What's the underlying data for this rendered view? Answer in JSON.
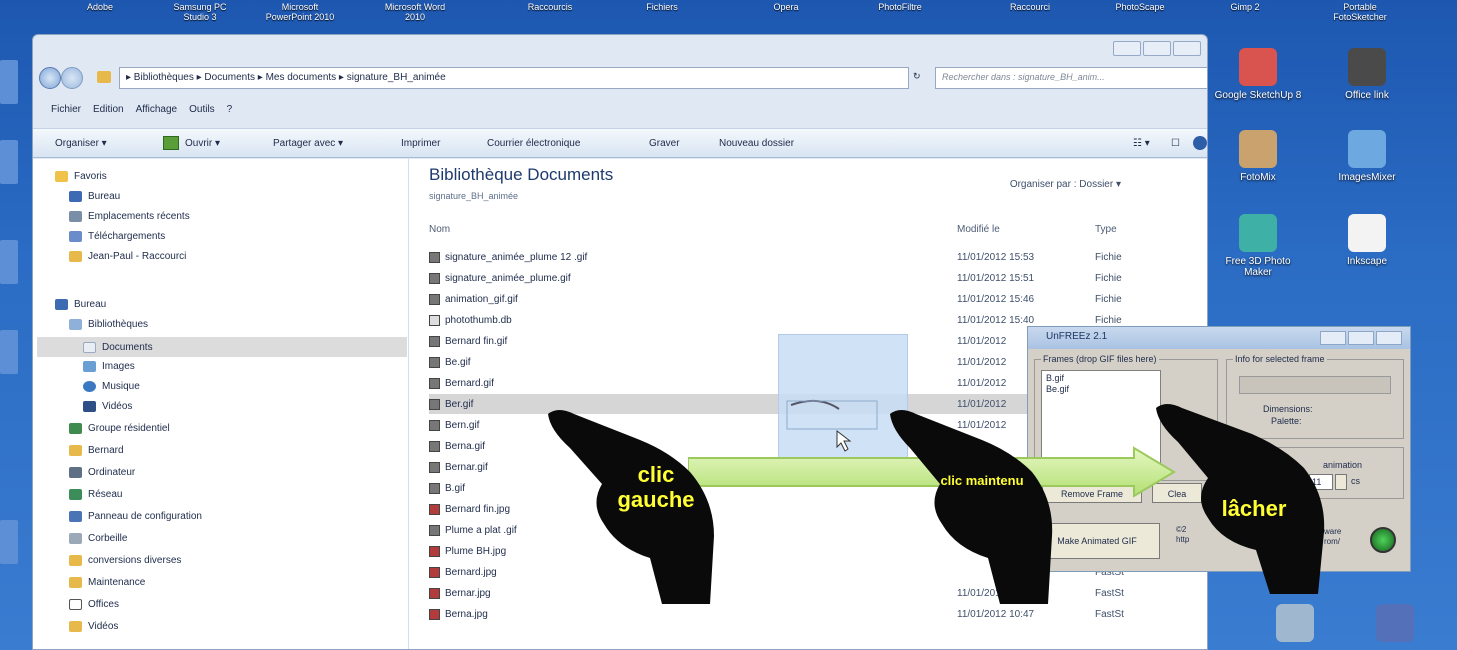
{
  "desktop": {
    "top_icons": [
      "Adobe",
      "Samsung PC Studio 3",
      "Microsoft PowerPoint 2010",
      "Microsoft Word 2010",
      "Raccourcis",
      "Fichiers",
      "Opera",
      "PhotoFiltre",
      "Raccourci",
      "PhotoScape",
      "Gimp 2",
      "Portable FotoSketcher"
    ],
    "right_icons": [
      {
        "name": "Google SketchUp 8",
        "color": "#d9534f"
      },
      {
        "name": "Office link",
        "color": "#4a4a4a"
      },
      {
        "name": "FotoMix",
        "color": "#c9a26e"
      },
      {
        "name": "ImagesMixer",
        "color": "#6ea8e0"
      },
      {
        "name": "Free 3D Photo Maker",
        "color": "#3fb0a6"
      },
      {
        "name": "Inkscape",
        "color": "#ffffff"
      }
    ]
  },
  "explorer": {
    "breadcrumb": "▸ Bibliothèques ▸ Documents ▸ Mes documents ▸ signature_BH_animée",
    "search_placeholder": "Rechercher dans : signature_BH_anim...",
    "menu": [
      "Fichier",
      "Edition",
      "Affichage",
      "Outils",
      "?"
    ],
    "toolbar": {
      "organize": "Organiser ▾",
      "open": "Ouvrir ▾",
      "share": "Partager avec ▾",
      "print": "Imprimer",
      "email": "Courrier électronique",
      "burn": "Graver",
      "new_folder": "Nouveau dossier"
    },
    "nav": {
      "favoris": "Favoris",
      "bureau1": "Bureau",
      "recent": "Emplacements récents",
      "downloads": "Téléchargements",
      "jeanpaul": "Jean-Paul - Raccourci",
      "bureau2": "Bureau",
      "libs": "Bibliothèques",
      "documents": "Documents",
      "images": "Images",
      "music": "Musique",
      "videos": "Vidéos",
      "homegroup": "Groupe résidentiel",
      "bernard": "Bernard",
      "computer": "Ordinateur",
      "network": "Réseau",
      "control": "Panneau de configuration",
      "trash": "Corbeille",
      "conversions": "conversions diverses",
      "maintenance": "Maintenance",
      "offices": "Offices",
      "videos2": "Vidéos"
    },
    "library": {
      "title": "Bibliothèque Documents",
      "subtitle": "signature_BH_animée",
      "arrange_label": "Organiser par :",
      "arrange_value": "Dossier ▾"
    },
    "columns": {
      "name": "Nom",
      "modified": "Modifié le",
      "type": "Type"
    },
    "files": [
      {
        "name": "signature_animée_plume 12 .gif",
        "date": "11/01/2012 15:53",
        "type": "Fichie"
      },
      {
        "name": "signature_animée_plume.gif",
        "date": "11/01/2012 15:51",
        "type": "Fichie"
      },
      {
        "name": "animation_gif.gif",
        "date": "11/01/2012 15:46",
        "type": "Fichie"
      },
      {
        "name": "photothumb.db",
        "date": "11/01/2012 15:40",
        "type": "Fichie"
      },
      {
        "name": "Bernard fin.gif",
        "date": "11/01/2012",
        "type": ""
      },
      {
        "name": "Be.gif",
        "date": "11/01/2012",
        "type": ""
      },
      {
        "name": "Bernard.gif",
        "date": "11/01/2012",
        "type": ""
      },
      {
        "name": "Ber.gif",
        "date": "11/01/2012",
        "type": ""
      },
      {
        "name": "Bern.gif",
        "date": "11/01/2012",
        "type": ""
      },
      {
        "name": "Berna.gif",
        "date": "",
        "type": ""
      },
      {
        "name": "Bernar.gif",
        "date": "",
        "type": ""
      },
      {
        "name": "B.gif",
        "date": "",
        "type": ""
      },
      {
        "name": "Bernard fin.jpg",
        "date": "",
        "type": ""
      },
      {
        "name": "Plume a plat .gif",
        "date": "",
        "type": ""
      },
      {
        "name": "Plume BH.jpg",
        "date": "",
        "type": ""
      },
      {
        "name": "Bernard.jpg",
        "date": "",
        "type": "FastSt"
      },
      {
        "name": "Bernar.jpg",
        "date": "11/01/2012 10:47",
        "type": "FastSt"
      },
      {
        "name": "Berna.jpg",
        "date": "11/01/2012 10:47",
        "type": "FastSt"
      }
    ]
  },
  "unfreez": {
    "title": "UnFREEz 2.1",
    "frames_legend": "Frames (drop GIF files here)",
    "frames": [
      "B.gif",
      "Be.gif"
    ],
    "info_legend": "Info for selected frame",
    "dimensions": "Dimensions:",
    "palette": "Palette:",
    "animation_label": "animation",
    "delay_value": "11",
    "delay_unit": "cs",
    "remove_frame": "Remove Frame",
    "clear": "Clea",
    "make_gif": "Make Animated GIF",
    "link_line1": "©2",
    "link_line2": "http",
    "link_tail1": "ware",
    "link_tail2": "rom/"
  },
  "annotations": {
    "left_click": "clic gauche",
    "hold_click": "clic maintenu",
    "release": "lâcher",
    "arrow_color": "#c6ec8a"
  }
}
